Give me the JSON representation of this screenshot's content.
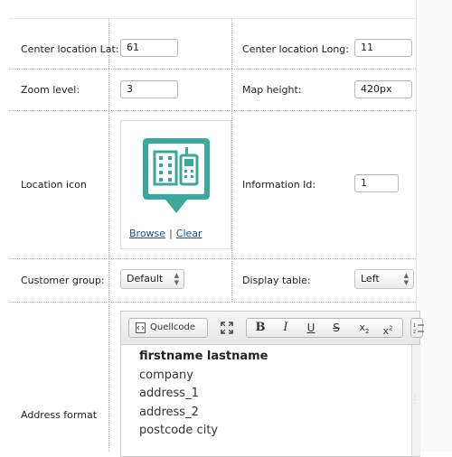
{
  "fields": {
    "center_lat": {
      "label": "Center location Lat:",
      "value": "61"
    },
    "center_long": {
      "label": "Center location Long:",
      "value": "11"
    },
    "zoom_level": {
      "label": "Zoom level:",
      "value": "3"
    },
    "map_height": {
      "label": "Map height:",
      "value": "420px"
    },
    "location_icon": {
      "label": "Location icon",
      "browse": "Browse",
      "separator": "|",
      "clear": "Clear",
      "icon": "building-phone-marker-icon"
    },
    "information_id": {
      "label": "Information Id:",
      "value": "1"
    },
    "customer_group": {
      "label": "Customer group:",
      "selected": "Default"
    },
    "display_table": {
      "label": "Display table:",
      "selected": "Left"
    },
    "address_format": {
      "label": "Address format"
    }
  },
  "editor": {
    "toolbar": {
      "source_label": "Quellcode",
      "source_icon": "source-code-icon",
      "maximize_icon": "maximize-icon",
      "bold": "B",
      "italic": "I",
      "underline": "U",
      "strike": "S",
      "subscript_icon": "subscript-icon",
      "superscript_icon": "superscript-icon",
      "numbered_list_icon": "numbered-list-icon"
    },
    "lines": [
      "firstname lastname",
      "company",
      "address_1",
      "address_2",
      "postcode city"
    ]
  },
  "colors": {
    "icon_teal": "#3aa89a",
    "link": "#1f4f8f"
  }
}
